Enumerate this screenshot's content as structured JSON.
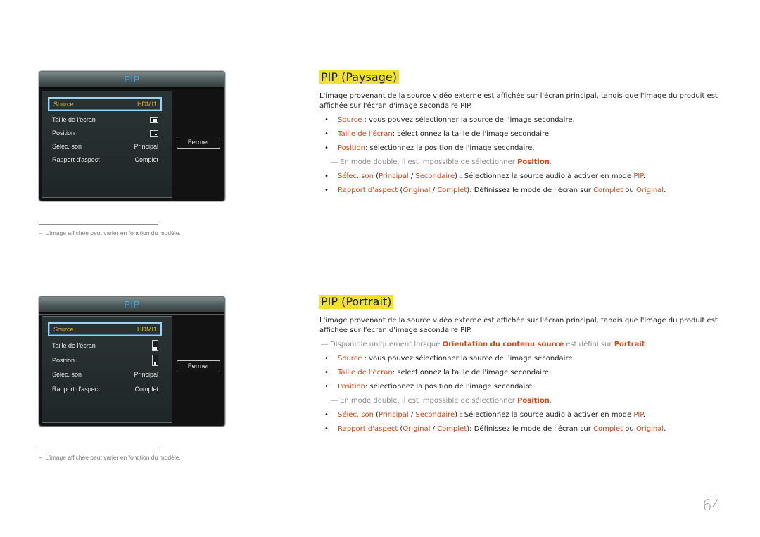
{
  "accent_color": "#d64515",
  "heading_highlight": "#f2e22c",
  "osd_paysage": {
    "title": "PIP",
    "rows": [
      {
        "label": "Source",
        "value": "HDMI1",
        "selected": true
      },
      {
        "label": "Taille de l'écran",
        "icon": "pip-size-landscape-icon"
      },
      {
        "label": "Position",
        "icon": "pip-position-landscape-icon"
      },
      {
        "label": "Sélec. son",
        "value": "Principal"
      },
      {
        "label": "Rapport d'aspect",
        "value": "Complet"
      }
    ],
    "close_label": "Fermer"
  },
  "osd_portrait": {
    "title": "PIP",
    "rows": [
      {
        "label": "Source",
        "value": "HDMI1",
        "selected": true
      },
      {
        "label": "Taille de l'écran",
        "icon": "pip-size-portrait-icon"
      },
      {
        "label": "Position",
        "icon": "pip-position-portrait-icon"
      },
      {
        "label": "Sélec. son",
        "value": "Principal"
      },
      {
        "label": "Rapport d'aspect",
        "value": "Complet"
      }
    ],
    "close_label": "Fermer"
  },
  "footnote": {
    "dash": "–",
    "text": "L'image affichée peut varier en fonction du modèle."
  },
  "section_paysage": {
    "heading": "PIP (Paysage)",
    "intro_line1": "L'image provenant de la source vidéo externe est affichée sur l'écran principal, tandis que l'image du produit est",
    "intro_line2": "affichée sur l'écran d'image secondaire PIP."
  },
  "section_portrait": {
    "heading": "PIP (Portrait)",
    "intro_line1": "L'image provenant de la source vidéo externe est affichée sur l'écran principal, tandis que l'image du produit est",
    "intro_line2": "affichée sur l'écran d'image secondaire PIP.",
    "note": {
      "pre": "Disponible uniquement lorsque ",
      "hl1": "Orientation du contenu source",
      "mid": " est défini sur ",
      "hl2": "Portrait",
      "post": "."
    }
  },
  "bullets": {
    "bullet_char": "•",
    "note_dash": "―",
    "source": {
      "term": "Source",
      "text": " : vous pouvez sélectionner la source de l'image secondaire."
    },
    "taille": {
      "term": "Taille de l'écran",
      "text": ": sélectionnez la taille de l'image secondaire."
    },
    "position": {
      "term": "Position",
      "text": ": sélectionnez la position de l'image secondaire."
    },
    "position_note": {
      "pre": "En mode double, il est impossible de sélectionner ",
      "hl": "Position",
      "post": "."
    },
    "son": {
      "term": "Sélec. son",
      "open": " (",
      "opt1": "Principal",
      "sep": " / ",
      "opt2": "Secondaire",
      "close": ") : Sélectionnez la source audio à activer en mode ",
      "hl": "PIP",
      "post": "."
    },
    "rapport": {
      "term": "Rapport d'aspect",
      "open": " (",
      "opt1": "Original",
      "sep": " / ",
      "opt2": "Complet",
      "close": "): Définissez le mode de l'écran sur ",
      "hl1": "Complet",
      "mid": " ou ",
      "hl2": "Original",
      "post": "."
    }
  },
  "page_number": "64"
}
